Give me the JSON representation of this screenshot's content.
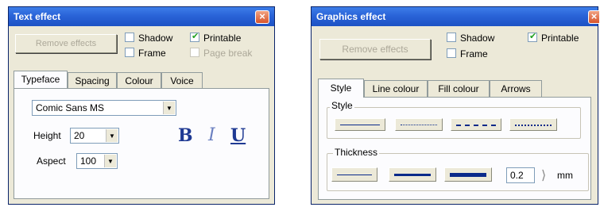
{
  "text_effect": {
    "title": "Text effect",
    "close_glyph": "×",
    "remove_label": "Remove effects",
    "checkboxes": [
      {
        "label": "Shadow",
        "checked": false,
        "enabled": true
      },
      {
        "label": "Printable",
        "checked": true,
        "enabled": true
      },
      {
        "label": "Frame",
        "checked": false,
        "enabled": true
      },
      {
        "label": "Page break",
        "checked": false,
        "enabled": false
      }
    ],
    "tabs": [
      "Typeface",
      "Spacing",
      "Colour",
      "Voice"
    ],
    "font_value": "Comic Sans MS",
    "height_label": "Height",
    "height_value": "20",
    "aspect_label": "Aspect",
    "aspect_value": "100",
    "bold_glyph": "B",
    "italic_glyph": "I",
    "underline_glyph": "U"
  },
  "graphics_effect": {
    "title": "Graphics effect",
    "close_glyph": "×",
    "remove_label": "Remove effects",
    "checkboxes": [
      {
        "label": "Shadow",
        "checked": false,
        "enabled": true
      },
      {
        "label": "Printable",
        "checked": true,
        "enabled": true
      },
      {
        "label": "Frame",
        "checked": false,
        "enabled": true
      }
    ],
    "tabs": [
      "Style",
      "Line colour",
      "Fill colour",
      "Arrows"
    ],
    "style_group_label": "Style",
    "thickness_group_label": "Thickness",
    "thickness_value": "0.2",
    "unit_label": "mm",
    "spinner_glyph": "⟩"
  },
  "colors": {
    "title_bar": "#2a63d8",
    "window_bg": "#ece9d8",
    "accent_blue": "#1f3a93",
    "line_blue": "#0a2a8a"
  }
}
